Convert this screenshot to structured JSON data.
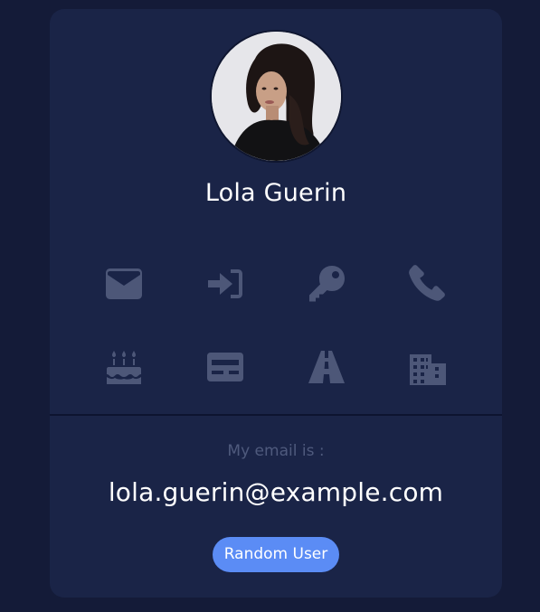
{
  "user": {
    "name": "Lola Guerin",
    "photo_alt": "avatar"
  },
  "icons": [
    "envelope-icon",
    "sign-in-icon",
    "key-icon",
    "phone-icon",
    "birthday-cake-icon",
    "id-card-icon",
    "road-icon",
    "building-icon"
  ],
  "info": {
    "label": "My email is :",
    "value": "lola.guerin@example.com"
  },
  "button": {
    "label": "Random User"
  },
  "colors": {
    "background": "#141b38",
    "card": "#1a2447",
    "icon": "#4d5778",
    "accent": "#5b8cf5"
  }
}
